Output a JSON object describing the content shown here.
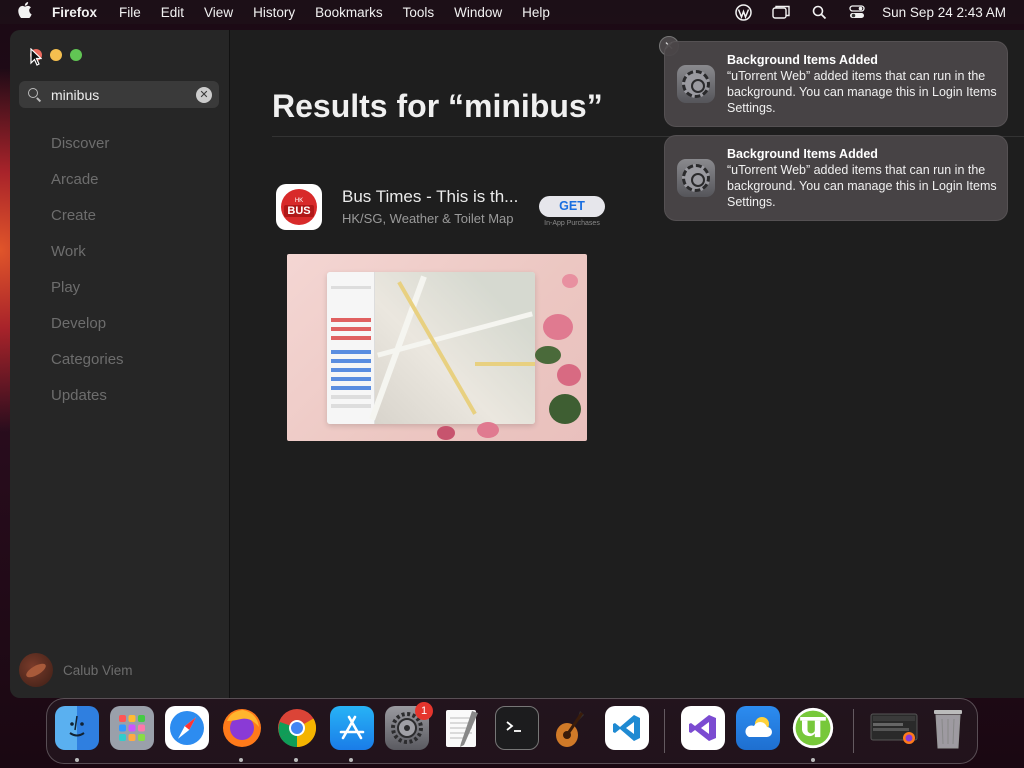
{
  "menubar": {
    "app_name": "Firefox",
    "menus": [
      "File",
      "Edit",
      "View",
      "History",
      "Bookmarks",
      "Tools",
      "Window",
      "Help"
    ],
    "clock": "Sun Sep 24  2:43 AM"
  },
  "sidebar": {
    "search_value": "minibus",
    "nav": [
      "Discover",
      "Arcade",
      "Create",
      "Work",
      "Play",
      "Develop",
      "Categories",
      "Updates"
    ],
    "user_name": "Calub Viem"
  },
  "main": {
    "results_title": "Results for “minibus”",
    "app": {
      "icon_top": "HK",
      "icon_label": "BUS",
      "name": "Bus Times - This is th...",
      "subtitle": "HK/SG, Weather & Toilet Map",
      "get_label": "GET",
      "iap_label": "In-App Purchases"
    }
  },
  "notifications": [
    {
      "title": "Background Items Added",
      "text": "“uTorrent Web” added items that can run in the background. You can manage this in Login Items Settings."
    },
    {
      "title": "Background Items Added",
      "text": "“uTorrent Web” added items that can run in the background. You can manage this in Login Items Settings."
    }
  ],
  "dock": {
    "items": [
      "finder-icon",
      "launchpad-icon",
      "safari-icon",
      "firefox-icon",
      "chrome-icon",
      "app-store-icon",
      "system-settings-icon",
      "textedit-icon",
      "terminal-icon",
      "garageband-icon",
      "vscode-icon",
      "visual-studio-icon",
      "weather-icon",
      "utorrent-icon",
      "screenshot-thumbnail",
      "trash-icon"
    ],
    "settings_badge": "1"
  },
  "colors": {
    "accent": "#1a6fe0",
    "close": "#ed6a5e",
    "minimize": "#f4bf4f",
    "maximize": "#61c554"
  }
}
